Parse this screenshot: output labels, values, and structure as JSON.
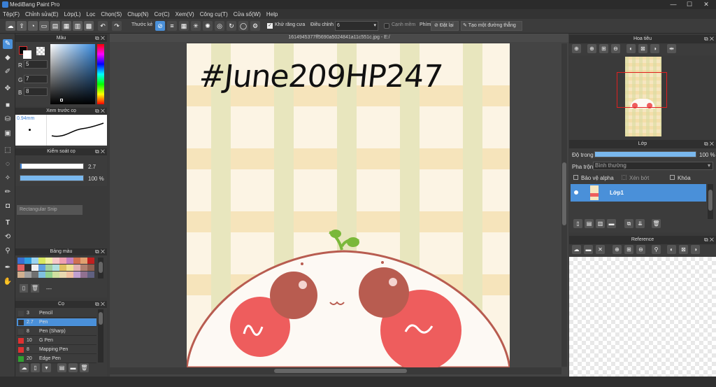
{
  "window": {
    "title": "MediBang Paint Pro",
    "minimize": "—",
    "maximize": "☐",
    "close": "✕"
  },
  "menu": [
    "Tệp(F)",
    "Chỉnh sửa(E)",
    "Lớp(L)",
    "Lọc",
    "Chọn(S)",
    "Chụp(N)",
    "Cơ(C)",
    "Xem(V)",
    "Công cụ(T)",
    "Cửa sổ(W)",
    "Help"
  ],
  "toolbar": {
    "ruler_label": "Thước kẻ",
    "antialias_label": "Khử răng cưa",
    "correction_label": "Điều chỉnh",
    "correction_value": "6",
    "soft_edge_label": "Cạnh mềm",
    "key_label": "Phím",
    "reset_label": "Đặt lại",
    "straight_line_label": "Tạo một đường thẳng"
  },
  "color_panel": {
    "title": "Màu",
    "r_label": "R",
    "r_value": "5",
    "g_label": "G",
    "g_value": "7",
    "b_label": "B",
    "b_value": "8",
    "fg_color": "#050708",
    "bg_color": "#ffffff"
  },
  "brush_preview": {
    "title": "Xem trước cọ",
    "size_text": "0.94mm"
  },
  "brush_control": {
    "title": "Kiểm soát cọ",
    "size_value": "2.7",
    "opacity_value": "100 %",
    "opacity_fraction": 1.0
  },
  "tooltip": {
    "text": "Rectangular Snip"
  },
  "palette_panel": {
    "title": "Bảng màu",
    "name": "---",
    "colors": [
      "#3a6fd0",
      "#2f9fe0",
      "#9bd3f0",
      "#d8e860",
      "#f0f0a0",
      "#f7c8c8",
      "#f0a0b0",
      "#c080c0",
      "#d07050",
      "#e0a070",
      "#c02020",
      "#e06060",
      "#303030",
      "#f0f0f0",
      "#60a0e0",
      "#a0d0a0",
      "#b0e0e0",
      "#e0c060",
      "#f0e090",
      "#e0b0b0",
      "#b08070",
      "#906050",
      "#d0b090",
      "#a0a0a0",
      "#707070",
      "#80c0e0",
      "#90d090",
      "#d0e0a0",
      "#e8d8b0",
      "#f0c0a0",
      "#c0a0d0",
      "#907090",
      "#606080"
    ]
  },
  "brush_panel": {
    "title": "Cọ",
    "items": [
      {
        "size": "3",
        "name": "Pencil",
        "color": "#444444"
      },
      {
        "size": "2.7",
        "name": "Pen",
        "color": "#333333"
      },
      {
        "size": "8",
        "name": "Pen (Sharp)",
        "color": "#444444"
      },
      {
        "size": "10",
        "name": "G Pen",
        "color": "#e03030"
      },
      {
        "size": "8",
        "name": "Mapping Pen",
        "color": "#e03030"
      },
      {
        "size": "20",
        "name": "Edge Pen",
        "color": "#30a030"
      }
    ]
  },
  "document": {
    "filename": "1614945377ff5690a5024841a11c551c.jpg - E:/"
  },
  "canvas": {
    "handwriting": "#June209HP247"
  },
  "navigator": {
    "title": "Hoa tiêu"
  },
  "layer_panel": {
    "title": "Lớp",
    "opacity_label": "Độ trong",
    "opacity_value": "100 %",
    "opacity_fraction": 1.0,
    "blend_label": "Pha trộn",
    "blend_value": "Bình thường",
    "protect_alpha_label": "Bảo vệ alpha",
    "clipping_label": "Xén bớt",
    "lock_label": "Khóa",
    "layers": [
      {
        "name": "Lớp1"
      }
    ]
  },
  "reference_panel": {
    "title": "Reference"
  }
}
